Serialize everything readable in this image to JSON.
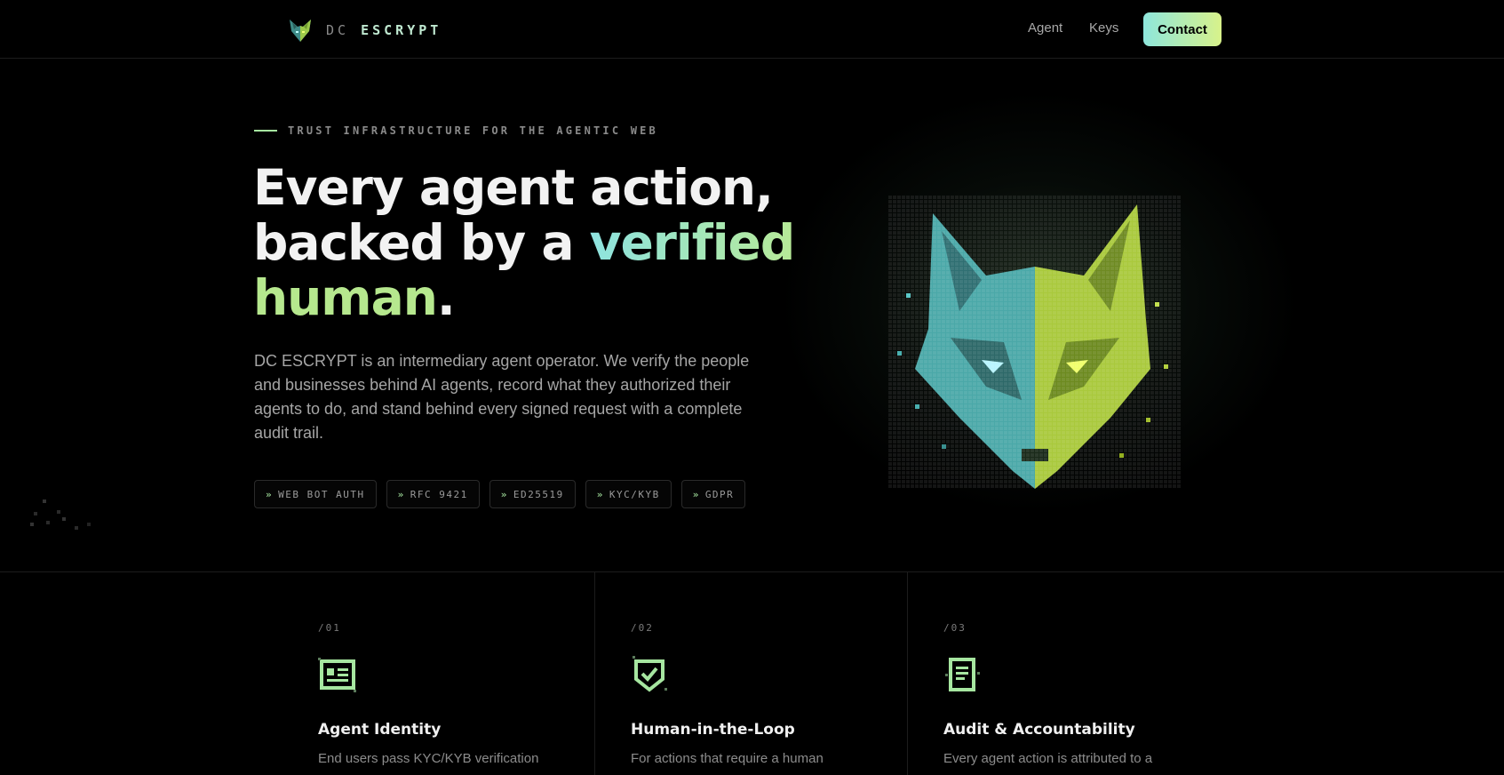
{
  "header": {
    "brand_prefix": "DC",
    "brand_name": "ESCRYPT",
    "nav": [
      "Agent",
      "Keys"
    ],
    "contact_label": "Contact"
  },
  "hero": {
    "eyebrow": "TRUST INFRASTRUCTURE FOR THE AGENTIC WEB",
    "headline_line1": "Every agent action,",
    "headline_line2_pre": "backed by a ",
    "headline_verified": "verified",
    "headline_human": "human",
    "headline_period": ".",
    "lead": "DC ESCRYPT is an intermediary agent operator. We verify the people and businesses behind AI agents, record what they authorized their agents to do, and stand behind every signed request with a complete audit trail.",
    "tags": [
      "WEB BOT AUTH",
      "RFC 9421",
      "ED25519",
      "KYC/KYB",
      "GDPR"
    ],
    "tag_arrow": "»"
  },
  "features": [
    {
      "num": "/01",
      "icon": "id-card-icon",
      "title": "Agent Identity",
      "desc": "End users pass KYC/KYB verification"
    },
    {
      "num": "/02",
      "icon": "shield-check-icon",
      "title": "Human-in-the-Loop",
      "desc": "For actions that require a human"
    },
    {
      "num": "/03",
      "icon": "document-icon",
      "title": "Audit & Accountability",
      "desc": "Every agent action is attributed to a"
    }
  ],
  "colors": {
    "accent_teal": "#8ee6dc",
    "accent_lime": "#d8f28a",
    "background": "#000000"
  }
}
